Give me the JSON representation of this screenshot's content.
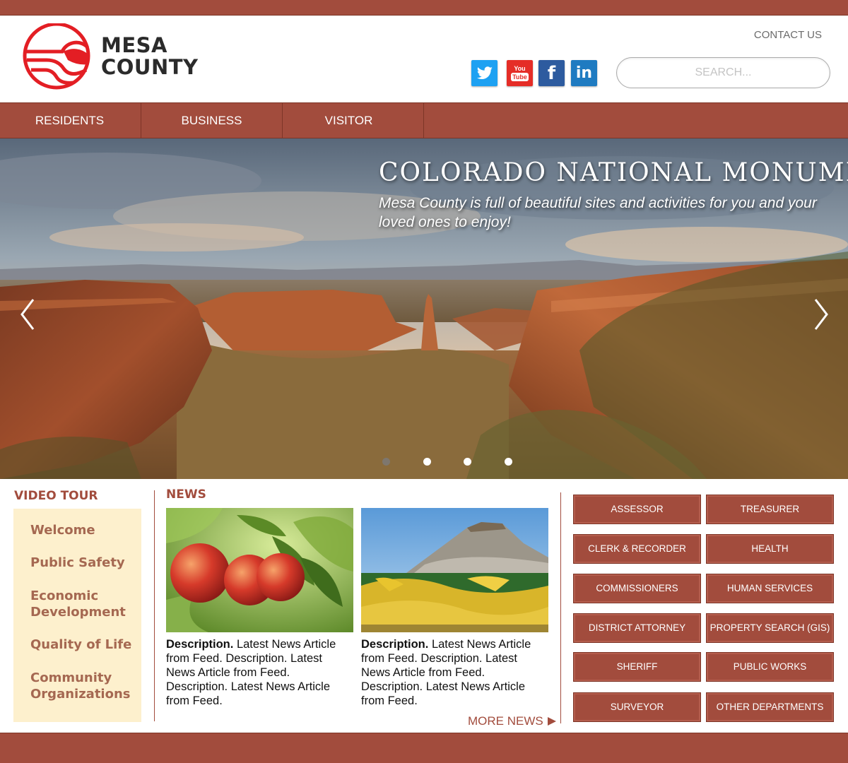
{
  "brand": {
    "name_line1": "MESA",
    "name_line2": "COUNTY",
    "logo_color": "#e31e24"
  },
  "header": {
    "contact_label": "CONTACT US",
    "social": [
      {
        "name": "twitter",
        "icon": "twitter-bird-icon",
        "color": "#1da1f2"
      },
      {
        "name": "youtube",
        "icon": "youtube-icon",
        "color": "#e52d27",
        "glyph_top": "You",
        "glyph_bottom": "Tube"
      },
      {
        "name": "facebook",
        "icon": "facebook-icon",
        "color": "#2d5b9f",
        "glyph": "f"
      },
      {
        "name": "linkedin",
        "icon": "linkedin-icon",
        "color": "#1f7bc1",
        "glyph": "in"
      }
    ],
    "search_placeholder": "SEARCH..."
  },
  "nav": {
    "items": [
      {
        "label": "RESIDENTS"
      },
      {
        "label": "BUSINESS"
      },
      {
        "label": "VISITOR"
      }
    ]
  },
  "hero": {
    "title": "COLORADO NATIONAL MONUMENT",
    "subtitle": "Mesa County is full of beautiful sites and activities for you and your loved ones to enjoy!",
    "prev_icon": "chevron-left-icon",
    "next_icon": "chevron-right-icon",
    "slide_count": 4,
    "active_slide": 1
  },
  "video_tour": {
    "title": "VIDEO TOUR",
    "links": [
      {
        "label": "Welcome"
      },
      {
        "label": "Public Safety"
      },
      {
        "label": "Economic Development"
      },
      {
        "label": "Quality of Life"
      },
      {
        "label": "Community Organizations"
      }
    ]
  },
  "news": {
    "title": "NEWS",
    "articles": [
      {
        "lead": "Description.",
        "body": " Latest News Article from Feed. Description. Latest News Article from Feed. Description. Latest News Article from Feed.",
        "image": "peaches"
      },
      {
        "lead": "Description.",
        "body": " Latest News Article from Feed. Description. Latest News Article from Feed. Description. Latest News Article from Feed.",
        "image": "mesa-autumn-landscape"
      }
    ],
    "more_label": "MORE NEWS"
  },
  "departments": [
    {
      "label": "ASSESSOR"
    },
    {
      "label": "TREASURER"
    },
    {
      "label": "CLERK & RECORDER"
    },
    {
      "label": "HEALTH"
    },
    {
      "label": "COMMISSIONERS"
    },
    {
      "label": "HUMAN SERVICES"
    },
    {
      "label": "DISTRICT ATTORNEY"
    },
    {
      "label": "PROPERTY SEARCH (GIS)"
    },
    {
      "label": "SHERIFF"
    },
    {
      "label": "PUBLIC WORKS"
    },
    {
      "label": "SURVEYOR"
    },
    {
      "label": "OTHER DEPARTMENTS"
    }
  ],
  "colors": {
    "brand_red_brown": "#a24c3d",
    "video_box_bg": "#fdf0cd",
    "video_link": "#a56851"
  }
}
